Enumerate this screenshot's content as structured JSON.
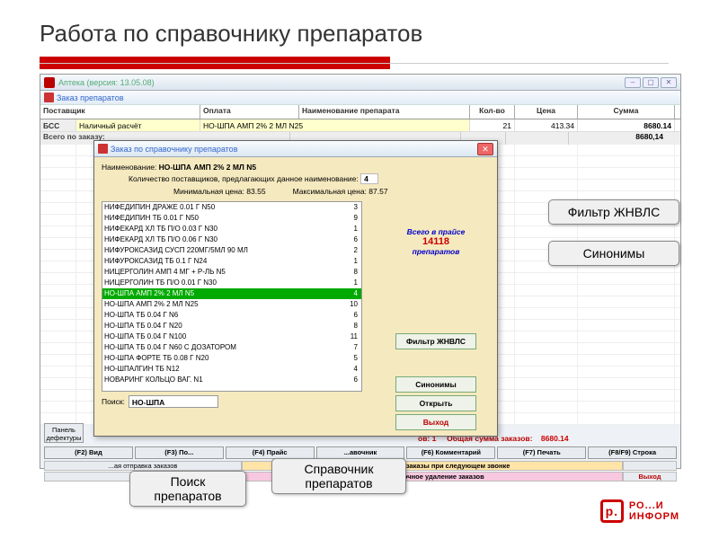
{
  "slide_title": "Работа по справочнику препаратов",
  "outer_window_title": "Аптека  (версия: 13.05.08)",
  "inner_window_title": "Заказ препаратов",
  "grid_header": {
    "supplier": "Поставщик",
    "payment": "Оплата",
    "drug_name": "Наименование препарата",
    "qty": "Кол-во",
    "price": "Цена",
    "sum": "Сумма"
  },
  "data_row": {
    "supplier_code": "БСС",
    "payment": "Наличный расчёт",
    "drug": "НО-ШПА АМП 2% 2 МЛ N25",
    "qty": "21",
    "price": "413.34",
    "sum": "8680.14"
  },
  "total_row": {
    "label": "Всего по заказу:",
    "sum": "8680,14"
  },
  "dialog": {
    "title": "Заказ по справочнику препаратов",
    "name_label": "Наименование:",
    "name_value": "НО-ШПА АМП 2% 2 МЛ  N5",
    "suppliers_label": "Количество поставщиков, предлагающих данное наименование:",
    "suppliers_value": "4",
    "min_price_label": "Минимальная цена:",
    "min_price_value": "83.55",
    "max_price_label": "Максимальная цена:",
    "max_price_value": "87.57",
    "price_total_1": "Всего в прайсе",
    "price_total_n": "14118",
    "price_total_2": "препаратов",
    "filter_btn": "Фильтр ЖНВЛС",
    "synonyms_btn": "Синонимы",
    "open_btn": "Открыть",
    "exit_btn": "Выход",
    "search_label": "Поиск:",
    "search_value": "НО-ШПА",
    "drugs": [
      {
        "n": "НИФЕДИПИН ДРАЖЕ 0.01 Г N50",
        "c": "3"
      },
      {
        "n": "НИФЕДИПИН ТБ 0.01 Г  N50",
        "c": "9"
      },
      {
        "n": "НИФЕКАРД ХЛ ТБ П/О 0.03 Г N30",
        "c": "1"
      },
      {
        "n": "НИФЕКАРД ХЛ ТБ П/О 0.06 Г N30",
        "c": "6"
      },
      {
        "n": "НИФУРОКСАЗИД СУСП 220МГ/5МЛ 90 МЛ",
        "c": "2"
      },
      {
        "n": "НИФУРОКСАЗИД ТБ 0.1 Г N24",
        "c": "1"
      },
      {
        "n": "НИЦЕРГОЛИН АМП 4 МГ + Р-ЛЬ N5",
        "c": "8"
      },
      {
        "n": "НИЦЕРГОЛИН ТБ П/О 0.01 Г N30",
        "c": "1"
      },
      {
        "n": "НО-ШПА АМП 2% 2 МЛ  N5",
        "c": "4",
        "sel": true
      },
      {
        "n": "НО-ШПА АМП 2% 2 МЛ N25",
        "c": "10"
      },
      {
        "n": "НО-ШПА ТБ 0.04 Г   N6",
        "c": "6"
      },
      {
        "n": "НО-ШПА ТБ 0.04 Г  N20",
        "c": "8"
      },
      {
        "n": "НО-ШПА ТБ 0.04 Г N100",
        "c": "11"
      },
      {
        "n": "НО-ШПА ТБ 0.04 Г N60 С ДОЗАТОРОМ",
        "c": "7"
      },
      {
        "n": "НО-ШПА ФОРТЕ ТБ 0.08 Г N20",
        "c": "5"
      },
      {
        "n": "НО-ШПАЛГИН ТБ N12",
        "c": "4"
      },
      {
        "n": "НОВАРИНГ КОЛЬЦО ВАГ. N1",
        "c": "6"
      }
    ]
  },
  "defect_btn": "Панель дефектуры",
  "fkeys": [
    "(F2) Вид",
    "(F3) По...",
    "(F4) Прайс",
    "...авочник",
    "(F6) Комментарий",
    "(F7) Печать",
    "(F8/F9) Строка"
  ],
  "action_rows": {
    "r1a": "...ая отправка заказов",
    "r1b": "Отправить все заказы при следующем звонке",
    "r2b": "Выборочное удаление заказов",
    "r2c": "Выход"
  },
  "summary": {
    "orders_label": "ов:",
    "orders_n": "1",
    "total_label": "Общая сумма заказов:",
    "total_n": "8680.14"
  },
  "callouts": {
    "search": "Поиск препаратов",
    "reference": "Справочник препаратов",
    "filter": "Фильтр ЖНВЛС",
    "synonyms": "Синонимы"
  },
  "logo": {
    "block1": "РО...И",
    "block2": "ИНФОРМ"
  }
}
